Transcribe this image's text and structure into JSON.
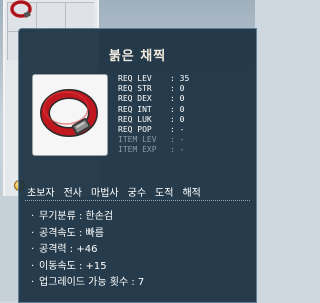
{
  "item": {
    "name": "붉은 채찍",
    "requirements": [
      {
        "label": "REQ LEV",
        "value": ": 35",
        "active": true
      },
      {
        "label": "REQ STR",
        "value": ": 0",
        "active": true
      },
      {
        "label": "REQ DEX",
        "value": ": 0",
        "active": true
      },
      {
        "label": "REQ INT",
        "value": ": 0",
        "active": true
      },
      {
        "label": "REQ LUK",
        "value": ": 0",
        "active": true
      },
      {
        "label": "REQ POP",
        "value": ": -",
        "active": true
      },
      {
        "label": "ITEM LEV",
        "value": ": -",
        "active": false
      },
      {
        "label": "ITEM EXP",
        "value": ": -",
        "active": false
      }
    ],
    "jobs": [
      "초보자",
      "전사",
      "마법사",
      "궁수",
      "도적",
      "해적"
    ],
    "stats": [
      {
        "text": "무기분류 : 한손검"
      },
      {
        "text": "공격속도 : 빠름"
      },
      {
        "text": "공격력 : +46"
      },
      {
        "text": "이동속도 : +15"
      },
      {
        "text": "업그레이드 가능 횟수 : 7"
      }
    ]
  },
  "colors": {
    "tooltip_bg": "#182f40",
    "whip_red": "#b8161b",
    "text_active": "#ffffff",
    "text_inactive": "#8a9aa5"
  }
}
